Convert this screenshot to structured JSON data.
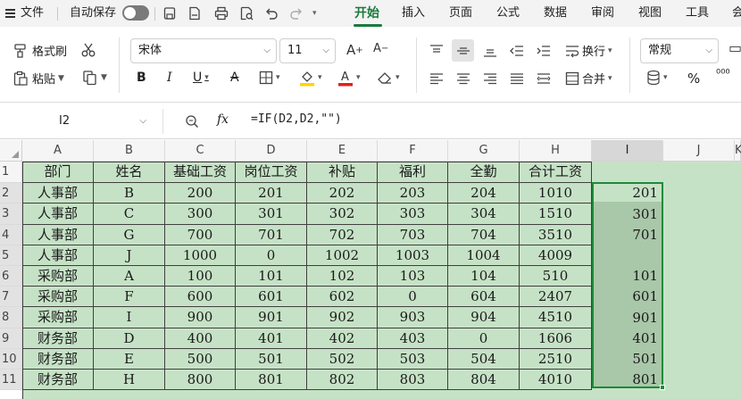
{
  "menubar": {
    "file": "文件",
    "autosave": "自动保存",
    "tabs": [
      "开始",
      "插入",
      "页面",
      "公式",
      "数据",
      "审阅",
      "视图",
      "工具",
      "会"
    ]
  },
  "ribbon": {
    "format_painter": "格式刷",
    "paste": "粘贴",
    "font_name": "宋体",
    "font_size": "11",
    "wrap": "换行",
    "merge": "合并",
    "number_format": "常规",
    "percent": "%",
    "thousands": "⁰⁰⁰"
  },
  "formula_bar": {
    "name_box": "I2",
    "fx": "fx",
    "formula": "=IF(D2,D2,\"\")"
  },
  "columns": [
    "A",
    "B",
    "C",
    "D",
    "E",
    "F",
    "G",
    "H",
    "I",
    "J",
    "K"
  ],
  "rows": [
    "1",
    "2",
    "3",
    "4",
    "5",
    "6",
    "7",
    "8",
    "9",
    "10",
    "11"
  ],
  "table": {
    "headers": [
      "部门",
      "姓名",
      "基础工资",
      "岗位工资",
      "补贴",
      "福利",
      "全勤",
      "合计工资"
    ],
    "data": [
      [
        "人事部",
        "B",
        "200",
        "201",
        "202",
        "203",
        "204",
        "1010"
      ],
      [
        "人事部",
        "C",
        "300",
        "301",
        "302",
        "303",
        "304",
        "1510"
      ],
      [
        "人事部",
        "G",
        "700",
        "701",
        "702",
        "703",
        "704",
        "3510"
      ],
      [
        "人事部",
        "J",
        "1000",
        "0",
        "1002",
        "1003",
        "1004",
        "4009"
      ],
      [
        "采购部",
        "A",
        "100",
        "101",
        "102",
        "103",
        "104",
        "510"
      ],
      [
        "采购部",
        "F",
        "600",
        "601",
        "602",
        "0",
        "604",
        "2407"
      ],
      [
        "采购部",
        "I",
        "900",
        "901",
        "902",
        "903",
        "904",
        "4510"
      ],
      [
        "财务部",
        "D",
        "400",
        "401",
        "402",
        "403",
        "0",
        "1606"
      ],
      [
        "财务部",
        "E",
        "500",
        "501",
        "502",
        "503",
        "504",
        "2510"
      ],
      [
        "财务部",
        "H",
        "800",
        "801",
        "802",
        "803",
        "804",
        "4010"
      ]
    ],
    "column_i": [
      "201",
      "301",
      "701",
      "",
      "101",
      "601",
      "901",
      "401",
      "501",
      "801"
    ]
  }
}
